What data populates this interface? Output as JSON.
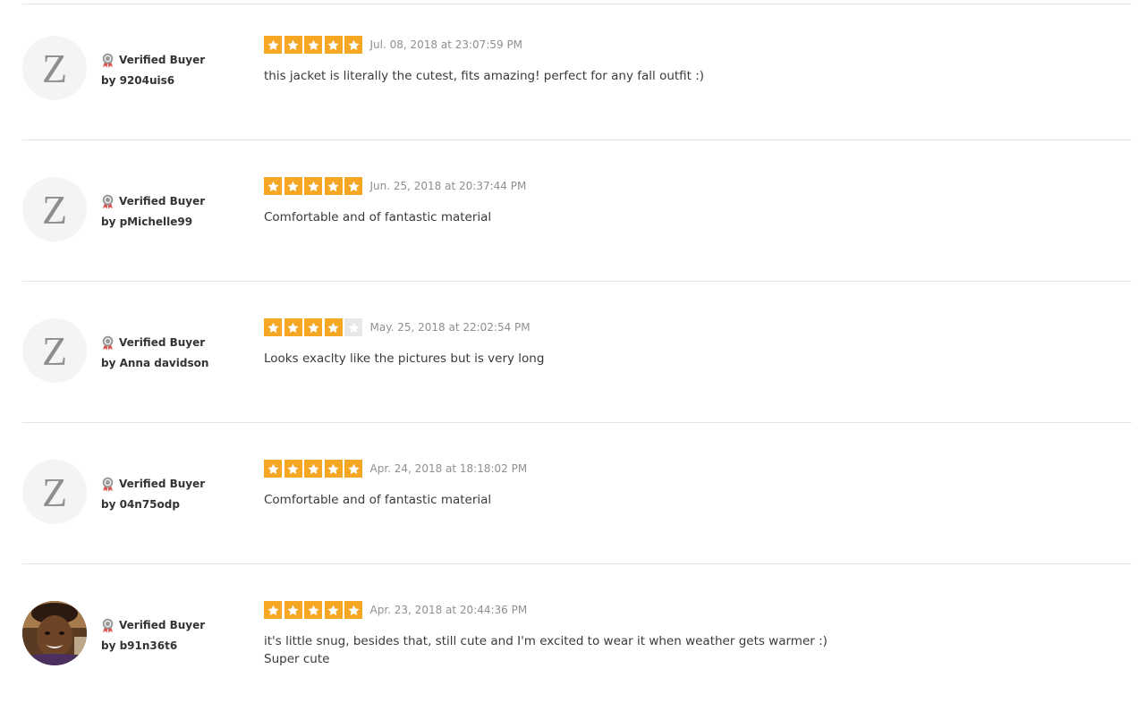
{
  "colors": {
    "star_fill": "#f5a623",
    "star_empty": "#e8e8e8",
    "divider": "#e3e3e3",
    "date": "#8f8f8f"
  },
  "reviews": [
    {
      "avatar": "brand-logo-z",
      "avatar_text": "Z",
      "badge": "Verified Buyer",
      "author": "by 9204uis6",
      "rating": 5,
      "date": "Jul. 08, 2018 at 23:07:59 PM",
      "text": [
        "this jacket is literally the cutest, fits amazing! perfect for any fall outfit :)"
      ]
    },
    {
      "avatar": "brand-logo-z",
      "avatar_text": "Z",
      "badge": "Verified Buyer",
      "author": "by pMichelle99",
      "rating": 5,
      "date": "Jun. 25, 2018 at 20:37:44 PM",
      "text": [
        "Comfortable and of fantastic material"
      ]
    },
    {
      "avatar": "brand-logo-z",
      "avatar_text": "Z",
      "badge": "Verified Buyer",
      "author": "by Anna davidson",
      "rating": 4,
      "date": "May. 25, 2018 at 22:02:54 PM",
      "text": [
        "Looks exaclty like the pictures but is very long"
      ]
    },
    {
      "avatar": "brand-logo-z",
      "avatar_text": "Z",
      "badge": "Verified Buyer",
      "author": "by 04n75odp",
      "rating": 5,
      "date": "Apr. 24, 2018 at 18:18:02 PM",
      "text": [
        "Comfortable and of fantastic material"
      ]
    },
    {
      "avatar": "user-photo",
      "avatar_text": "",
      "badge": "Verified Buyer",
      "author": "by b91n36t6",
      "rating": 5,
      "date": "Apr. 23, 2018 at 20:44:36 PM",
      "text": [
        "it's little snug, besides that, still cute and I'm excited to wear it when weather gets warmer :)",
        "Super cute"
      ]
    }
  ]
}
